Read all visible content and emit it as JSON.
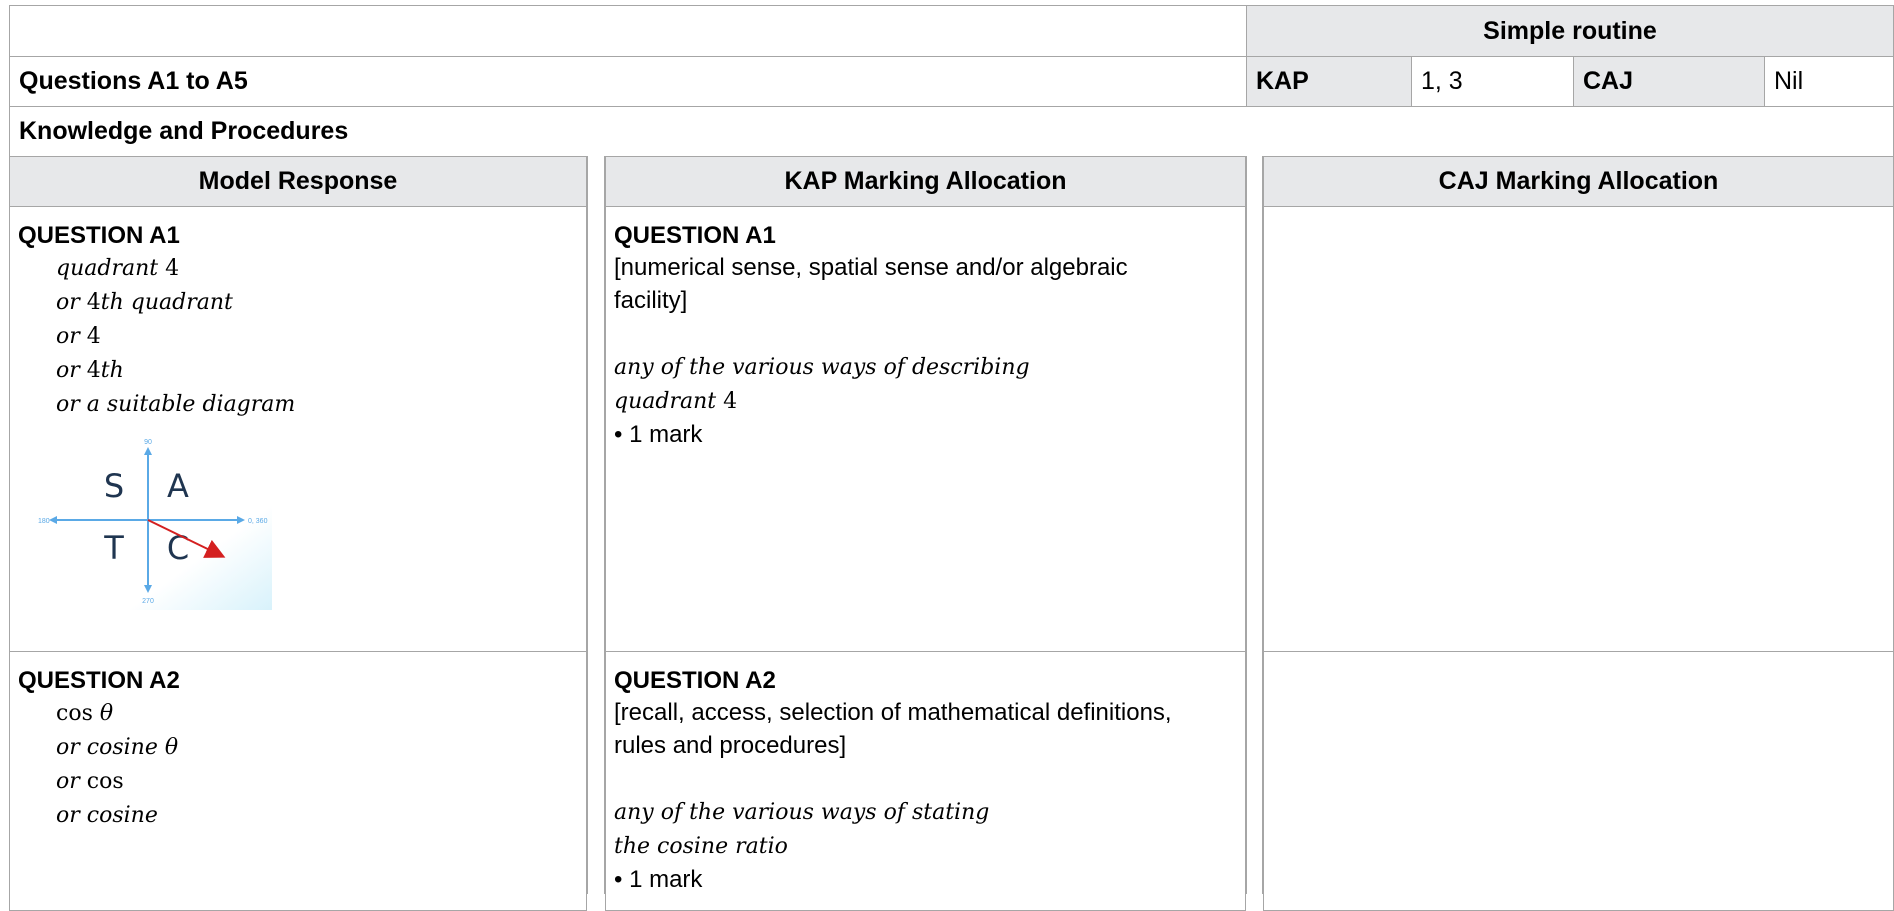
{
  "header": {
    "routine": "Simple routine",
    "questions_range": "Questions A1 to A5",
    "kap_label": "KAP",
    "kap_value": "1, 3",
    "caj_label": "CAJ",
    "caj_value": "Nil",
    "section_title": "Knowledge and Procedures"
  },
  "columns": {
    "model_response": "Model Response",
    "kap_allocation": "KAP Marking Allocation",
    "caj_allocation": "CAJ Marking Allocation"
  },
  "questions": [
    {
      "title": "QUESTION A1",
      "model_lines": [
        {
          "pre": "",
          "main": "quadrant",
          "num": " 4",
          "post": ""
        },
        {
          "pre": "or ",
          "main": "",
          "num": "4",
          "post": "th quadrant"
        },
        {
          "pre": "or ",
          "main": "",
          "num": "4",
          "post": ""
        },
        {
          "pre": "or ",
          "main": "",
          "num": "4",
          "post": "th"
        },
        {
          "pre": "or a suitable diagram",
          "main": "",
          "num": "",
          "post": ""
        }
      ],
      "diagram": {
        "quadrants": [
          "S",
          "A",
          "T",
          "C"
        ],
        "axis_labels": {
          "top": "90",
          "left": "180",
          "right": "0, 360",
          "bottom": "270"
        }
      },
      "kap_title": "QUESTION A1",
      "kap_desc": "[numerical sense, spatial sense and/or algebraic facility]",
      "kap_ways_line1": "any of the various ways of describing",
      "kap_ways_line2_text": "quadrant",
      "kap_ways_line2_num": " 4",
      "kap_mark": "1 mark"
    },
    {
      "title": "QUESTION A2",
      "model_lines_a2": [
        {
          "pre_normal": "cos ",
          "italic": "θ"
        },
        {
          "pre_normal": "",
          "italic": "or cosine θ"
        },
        {
          "pre_italic": "or ",
          "normal": "cos"
        },
        {
          "pre_normal": "",
          "italic": "or cosine"
        }
      ],
      "kap_title": "QUESTION A2",
      "kap_desc": "[recall, access, selection of mathematical definitions, rules and procedures]",
      "kap_ways_line1": "any of the various ways of stating",
      "kap_ways_line2": "the cosine ratio",
      "kap_mark": "1 mark"
    }
  ],
  "colors": {
    "header_fill": "#e7e8ea",
    "border": "#a6a6a6",
    "diagram_axis": "#5aa9e6",
    "diagram_arrow": "#d42020",
    "diagram_letters": "#1f3550"
  },
  "icons": {
    "bullet": "bullet-icon"
  }
}
